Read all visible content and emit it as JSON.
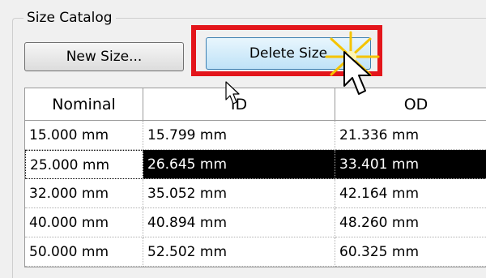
{
  "group": {
    "title": "Size Catalog"
  },
  "toolbar": {
    "new_size_label": "New Size...",
    "delete_size_label": "Delete Size"
  },
  "table": {
    "headers": [
      "Nominal",
      "ID",
      "OD"
    ],
    "rows": [
      {
        "nominal": "15.000 mm",
        "id": "15.799 mm",
        "od": "21.336 mm"
      },
      {
        "nominal": "25.000 mm",
        "id": "26.645 mm",
        "od": "33.401 mm"
      },
      {
        "nominal": "32.000 mm",
        "id": "35.052 mm",
        "od": "42.164 mm"
      },
      {
        "nominal": "40.000 mm",
        "id": "40.894 mm",
        "od": "48.260 mm"
      },
      {
        "nominal": "50.000 mm",
        "id": "52.502 mm",
        "od": "60.325 mm"
      }
    ],
    "selected_row": 1
  },
  "colors": {
    "highlight": "#e3151b",
    "selection": "#000000",
    "button_accent": "#3c7fb1"
  },
  "icons": [
    "arrow-cursor-icon",
    "click-burst-icon"
  ]
}
